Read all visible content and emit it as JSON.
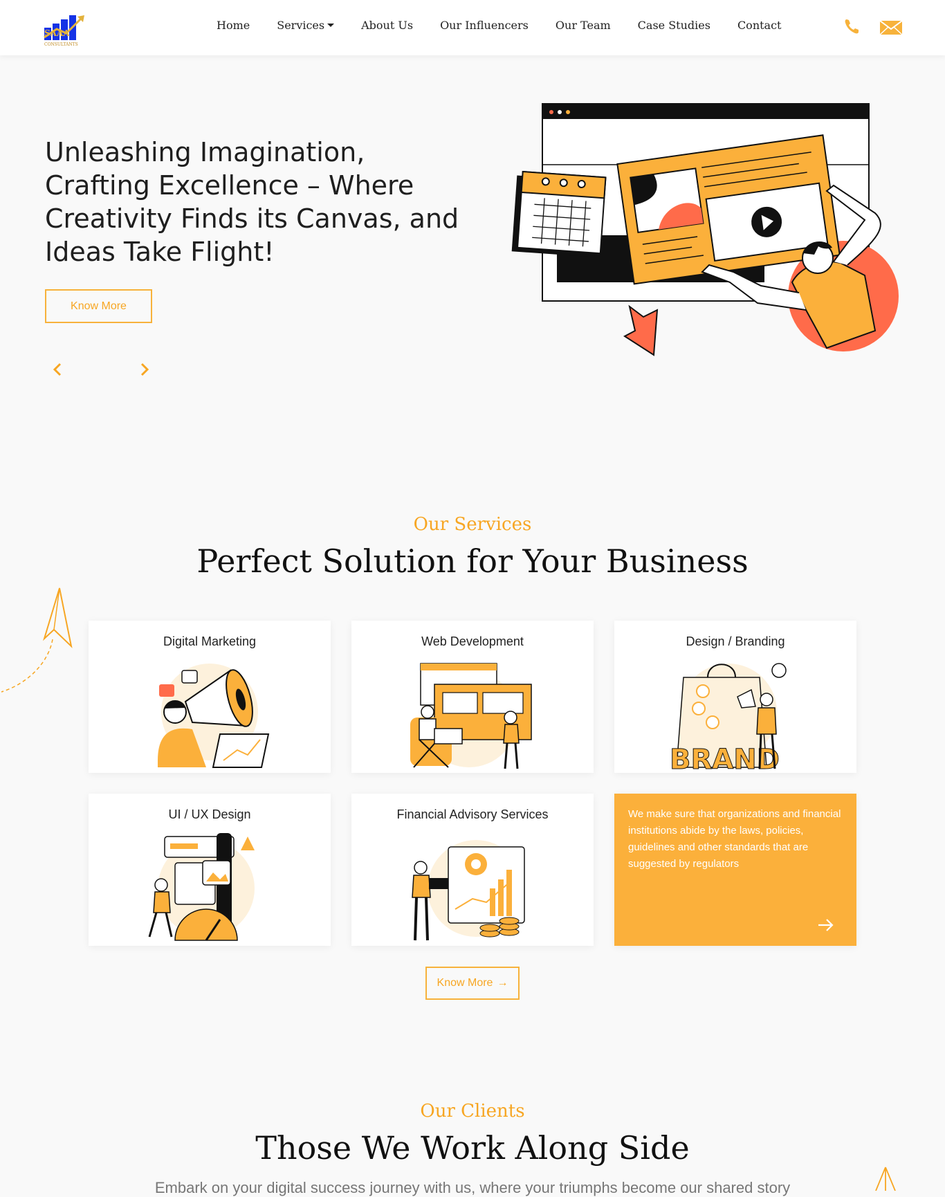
{
  "header": {
    "logo_icon": "saaa-consultants-logo",
    "nav": [
      {
        "label": "Home"
      },
      {
        "label": "Services",
        "dropdown": true
      },
      {
        "label": "About Us"
      },
      {
        "label": "Our Influencers"
      },
      {
        "label": "Our Team"
      },
      {
        "label": "Case Studies"
      },
      {
        "label": "Contact"
      }
    ],
    "phone_icon": "phone-icon",
    "mail_icon": "mail-icon"
  },
  "hero": {
    "title": "Unleashing Imagination, Crafting Excellence – Where Creativity Finds its Canvas, and Ideas Take Flight!",
    "button_label": "Know More",
    "prev_icon": "chevron-left-icon",
    "next_icon": "chevron-right-icon"
  },
  "services": {
    "kicker": "Our Services",
    "title": "Perfect Solution for Your Business",
    "cards": [
      {
        "title": "Digital Marketing"
      },
      {
        "title": "Web Development"
      },
      {
        "title": "Design / Branding"
      },
      {
        "title": "UI / UX Design"
      },
      {
        "title": "Financial Advisory Services"
      }
    ],
    "highlight_text": "We make sure that organizations and financial institutions abide by the laws, policies, guidelines and other standards that are suggested by regulators",
    "button_label": "Know More",
    "button_arrow": "→"
  },
  "clients": {
    "kicker": "Our Clients",
    "title": "Those We Work Along Side",
    "subtitle": "Embark on your digital success journey with us, where your triumphs become our shared story"
  },
  "colors": {
    "accent": "#fbb03b",
    "accent_text": "#f7a623",
    "coral": "#ff6b4a",
    "dark": "#111111"
  }
}
